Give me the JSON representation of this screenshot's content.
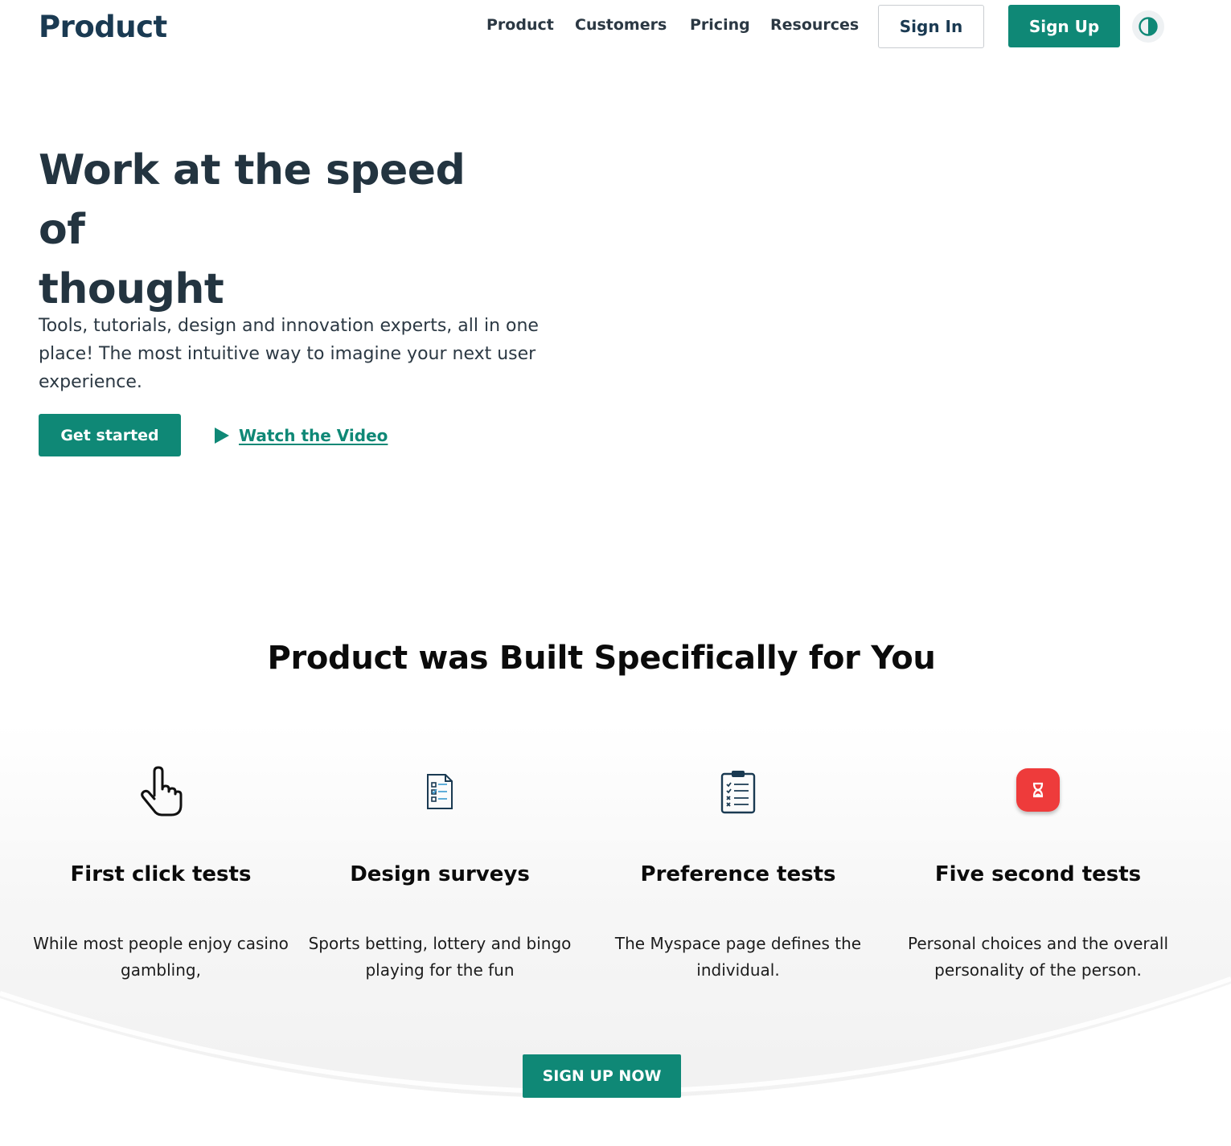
{
  "nav": {
    "brand": "Product",
    "links": [
      "Product",
      "Customers",
      "Pricing",
      "Resources"
    ],
    "sign_in": "Sign In",
    "sign_up": "Sign Up",
    "theme_icon": "contrast-icon"
  },
  "hero": {
    "title_line1": "Work at the speed of",
    "title_line2": "thought",
    "description": "Tools, tutorials, design and innovation experts, all in one place! The most intuitive way to imagine your next user experience.",
    "cta_primary": "Get started",
    "cta_secondary": "Watch the Video"
  },
  "features": {
    "title": "Product was Built Specifically for You",
    "items": [
      {
        "icon": "pointer-hand-icon",
        "title": "First click tests",
        "description": "While most people enjoy casino gambling,"
      },
      {
        "icon": "survey-document-icon",
        "title": "Design surveys",
        "description": "Sports betting, lottery and bingo playing for the fun"
      },
      {
        "icon": "clipboard-checklist-icon",
        "title": "Preference tests",
        "description": "The Myspace page defines the individual."
      },
      {
        "icon": "hourglass-icon",
        "title": "Five second tests",
        "description": "Personal choices and the overall personality of the person."
      }
    ],
    "cta": "SIGN UP NOW"
  },
  "colors": {
    "brand": "#1a3a52",
    "accent": "#0f8876",
    "heading": "#233440",
    "red_badge": "#ee3b3b"
  }
}
